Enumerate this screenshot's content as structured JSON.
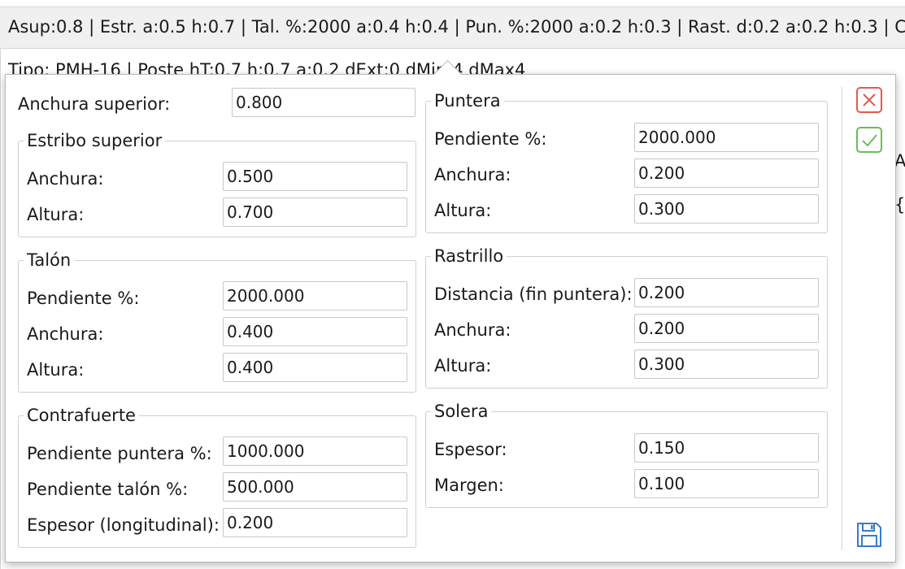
{
  "background": {
    "summary_bar": "Asup:0.8 | Estr. a:0.5 h:0.7 | Tal. %:2000 a:0.4 h:0.4 | Pun. %:2000 a:0.2 h:0.3 | Rast. d:0.2 a:0.2 h:0.3 | Contr. p",
    "line2": "Tipo: PMH-16 | Poste hT:0.7 h:0.7 a:0.2 dExt:0 dMin:4 dMax4",
    "right_text_1": "Ar",
    "right_text_2": "{c"
  },
  "form": {
    "top": {
      "label": "Anchura superior:",
      "value": "0.800"
    },
    "estribo": {
      "title": "Estribo superior",
      "anchura": {
        "label": "Anchura:",
        "value": "0.500"
      },
      "altura": {
        "label": "Altura:",
        "value": "0.700"
      }
    },
    "talon": {
      "title": "Talón",
      "pendiente": {
        "label": "Pendiente %:",
        "value": "2000.000"
      },
      "anchura": {
        "label": "Anchura:",
        "value": "0.400"
      },
      "altura": {
        "label": "Altura:",
        "value": "0.400"
      }
    },
    "contrafuerte": {
      "title": "Contrafuerte",
      "pend_puntera": {
        "label": "Pendiente puntera %:",
        "value": "1000.000"
      },
      "pend_talon": {
        "label": "Pendiente talón %:",
        "value": "500.000"
      },
      "espesor": {
        "label": "Espesor (longitudinal):",
        "value": "0.200"
      }
    },
    "puntera": {
      "title": "Puntera",
      "pendiente": {
        "label": "Pendiente %:",
        "value": "2000.000"
      },
      "anchura": {
        "label": "Anchura:",
        "value": "0.200"
      },
      "altura": {
        "label": "Altura:",
        "value": "0.300"
      }
    },
    "rastrillo": {
      "title": "Rastrillo",
      "distancia": {
        "label": "Distancia (fin puntera):",
        "value": "0.200"
      },
      "anchura": {
        "label": "Anchura:",
        "value": "0.200"
      },
      "altura": {
        "label": "Altura:",
        "value": "0.300"
      }
    },
    "solera": {
      "title": "Solera",
      "espesor": {
        "label": "Espesor:",
        "value": "0.150"
      },
      "margen": {
        "label": "Margen:",
        "value": "0.100"
      }
    }
  },
  "icons": {
    "close": {
      "name": "close-icon",
      "color": "#e05a4f"
    },
    "confirm": {
      "name": "check-icon",
      "color": "#6dbb5a"
    },
    "save": {
      "name": "save-icon",
      "color": "#3a7bc8"
    }
  }
}
